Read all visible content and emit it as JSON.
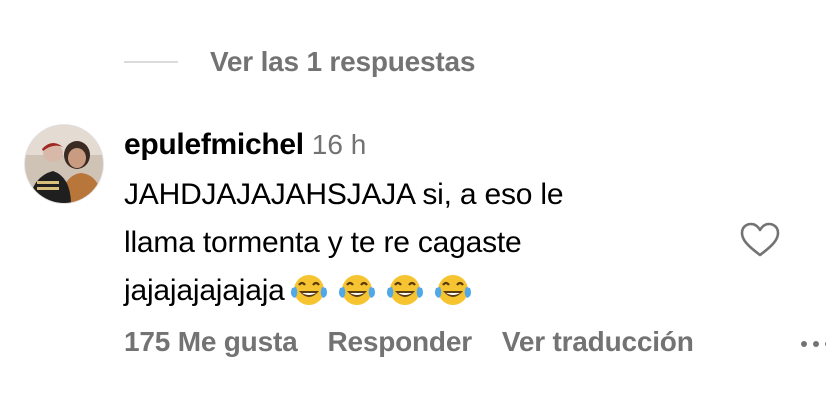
{
  "replies": {
    "label": "Ver las 1 respuestas"
  },
  "comment": {
    "username": "epulefmichel",
    "timestamp": "16 h",
    "text_lines": [
      "JAHDJAJAJAHSJAJA si, a eso le",
      "llama tormenta y te re cagaste",
      "jajajajajajaja"
    ],
    "trailing_emojis": [
      "face-with-tears-of-joy",
      "face-with-tears-of-joy",
      "face-with-tears-of-joy",
      "face-with-tears-of-joy"
    ],
    "liked": false
  },
  "actions": {
    "likes_label": "175 Me gusta",
    "reply_label": "Responder",
    "translate_label": "Ver traducción"
  },
  "icons": {
    "heart": "heart-outline-icon",
    "more": "more-options-icon"
  },
  "colors": {
    "text_primary": "#000000",
    "text_secondary": "#737373",
    "divider": "#dbdbdb"
  }
}
